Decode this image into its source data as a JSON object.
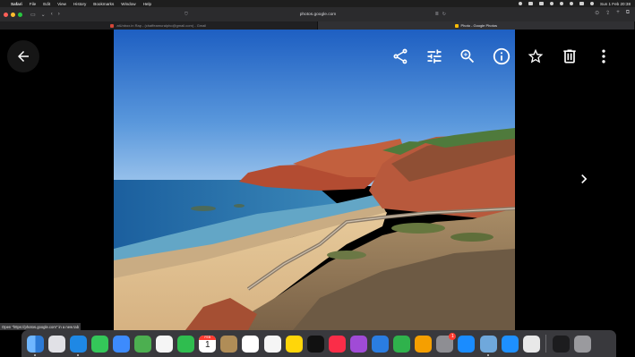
{
  "menubar": {
    "apple": "",
    "app_name": "Safari",
    "items": [
      "File",
      "Edit",
      "View",
      "History",
      "Bookmarks",
      "Window",
      "Help"
    ],
    "clock": "Sun 1 Feb 20:38"
  },
  "toolbar": {
    "url": "photos.google.com",
    "reader_icon": "reader-icon",
    "reload_icon": "reload-icon"
  },
  "tabs": [
    {
      "title": "atUnbox.in Rap - (chaffeamuralpho@gmail.com) - Gmail",
      "active": false,
      "favicon_color": "#d44638"
    },
    {
      "title": "Photo - Google Photos",
      "active": true,
      "favicon_color": "#fbbc05"
    }
  ],
  "viewer": {
    "back_icon": "arrow-left-icon",
    "next_icon": "chevron-right-icon",
    "actions": [
      "share-icon",
      "edit-tune-icon",
      "zoom-in-icon",
      "info-icon",
      "star-icon",
      "trash-icon",
      "more-vert-icon"
    ]
  },
  "status_bar": {
    "text": "Open \"https://photos.google.com\" in a new tab"
  },
  "dock": {
    "calendar_month": "FEB",
    "calendar_day": "1",
    "system_settings_badge": "1",
    "apps": [
      {
        "name": "finder-icon",
        "color": "#3b8fe6"
      },
      {
        "name": "launchpad-icon",
        "color": "#d9d9d9"
      },
      {
        "name": "safari-icon",
        "color": "#1e88e5"
      },
      {
        "name": "messages-icon",
        "color": "#34c759"
      },
      {
        "name": "mail-icon",
        "color": "#3d8bfd"
      },
      {
        "name": "maps-icon",
        "color": "#4caf50"
      },
      {
        "name": "photos-icon",
        "color": "#f5f5f5"
      },
      {
        "name": "facetime-icon",
        "color": "#2fbd4f"
      },
      {
        "name": "calendar-icon",
        "color": "#ffffff"
      },
      {
        "name": "contacts-icon",
        "color": "#b08d57"
      },
      {
        "name": "reminders-icon",
        "color": "#ffffff"
      },
      {
        "name": "freeform-icon",
        "color": "#f5f5f5"
      },
      {
        "name": "notes-icon",
        "color": "#ffd60a"
      },
      {
        "name": "apple-tv-icon",
        "color": "#111111"
      },
      {
        "name": "music-icon",
        "color": "#fa2d48"
      },
      {
        "name": "podcasts-icon",
        "color": "#a04bd6"
      },
      {
        "name": "keynote-icon",
        "color": "#2a7de1"
      },
      {
        "name": "numbers-icon",
        "color": "#2fb24c"
      },
      {
        "name": "pages-icon",
        "color": "#f59f00"
      },
      {
        "name": "system-settings-icon",
        "color": "#8e8e93"
      },
      {
        "name": "app-store-icon",
        "color": "#1a8cff"
      },
      {
        "name": "preview-icon",
        "color": "#6fa8dc"
      },
      {
        "name": "bluetooth-icon",
        "color": "#1e90ff"
      },
      {
        "name": "quicktime-icon",
        "color": "#e8e8e8"
      },
      {
        "name": "iphone-mirroring-icon",
        "color": "#1c1c1e"
      },
      {
        "name": "trash-dock-icon",
        "color": "#9a9a9e"
      }
    ]
  }
}
